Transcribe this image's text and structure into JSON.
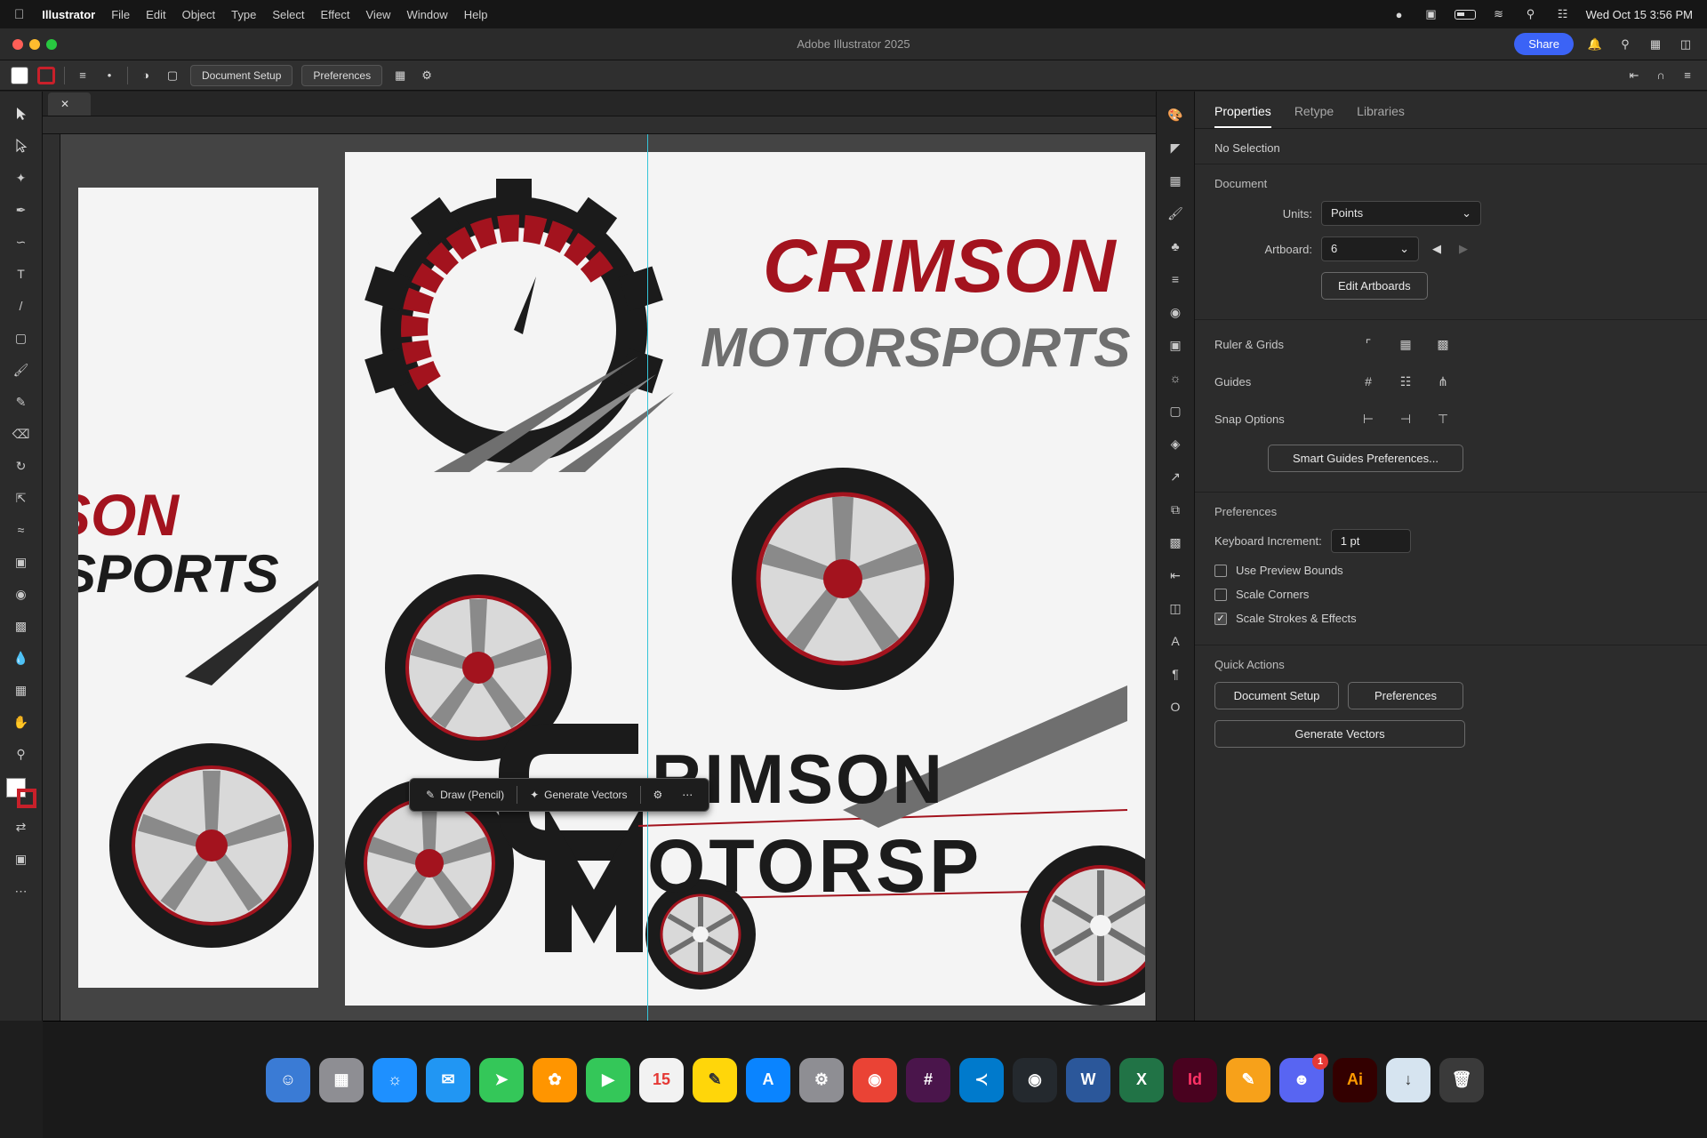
{
  "menubar": {
    "menus": [
      "Illustrator",
      "File",
      "Edit",
      "Object",
      "Type",
      "Select",
      "Effect",
      "View",
      "Window",
      "Help"
    ],
    "clock": "Wed Oct 15  3:56 PM"
  },
  "titlebar": {
    "app_title": "Adobe Illustrator 2025",
    "share_label": "Share"
  },
  "controlbar": {
    "document_setup": "Document Setup",
    "preferences": "Preferences"
  },
  "canvas": {
    "logo_a": {
      "line1": "CRIMSON",
      "line2": "MOTORSPORTS"
    },
    "logo_b": {
      "line1": "RIMSON",
      "line2": "OTORSP"
    },
    "left_partial": {
      "line1": "SON",
      "line2": "SPORTS"
    },
    "brand_red": "#a3131e",
    "tire_dark": "#1b1b1b",
    "spoke_gray": "#8a8a8a"
  },
  "taskbar": {
    "draw_label": "Draw (Pencil)",
    "generate_label": "Generate Vectors"
  },
  "panel": {
    "tabs": [
      "Properties",
      "Retype",
      "Libraries"
    ],
    "selection": "No Selection",
    "document_heading": "Document",
    "units_label": "Units:",
    "units_value": "Points",
    "artboard_label": "Artboard:",
    "artboard_value": "6",
    "edit_artboards": "Edit Artboards",
    "ruler_grids": "Ruler & Grids",
    "guides": "Guides",
    "snap_options": "Snap Options",
    "smart_guides": "Smart Guides Preferences...",
    "preferences_heading": "Preferences",
    "keyboard_increment_label": "Keyboard Increment:",
    "keyboard_increment_value": "1 pt",
    "use_preview_bounds": "Use Preview Bounds",
    "scale_corners": "Scale Corners",
    "scale_strokes": "Scale Strokes & Effects",
    "quick_actions": "Quick Actions",
    "qa_document_setup": "Document Setup",
    "qa_preferences": "Preferences",
    "qa_generate_vectors": "Generate Vectors"
  },
  "dock": {
    "illustrator": "Ai",
    "indesign": "Id",
    "discord_badge": "1"
  }
}
